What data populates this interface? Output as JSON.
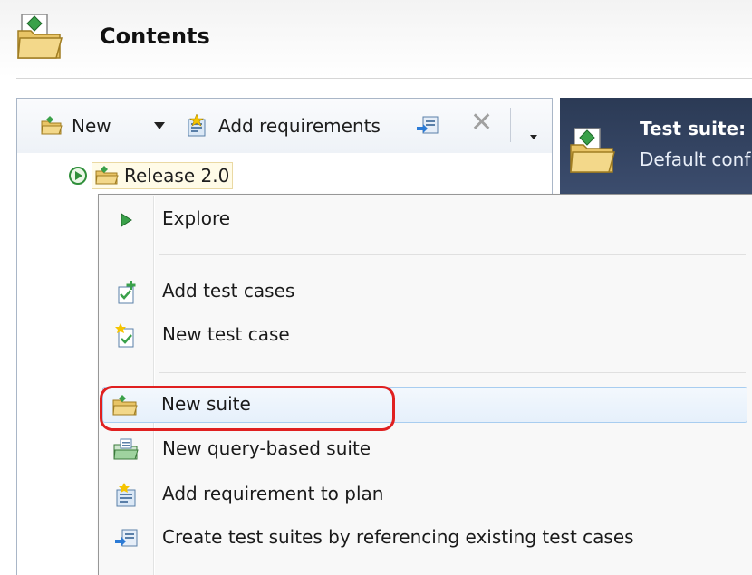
{
  "header": {
    "title": "Contents",
    "icon": "folder-suite-icon"
  },
  "toolbar": {
    "new_label": "New",
    "add_requirements_label": "Add requirements",
    "icons": [
      "new-suite-icon",
      "dropdown-arrow-icon",
      "add-requirements-icon",
      "reference-suites-icon",
      "delete-icon",
      "overflow-icon"
    ]
  },
  "tree": {
    "root_label": "Release 2.0",
    "icons": [
      "expand-run-icon",
      "suite-folder-icon"
    ]
  },
  "right_panel": {
    "title": "Test suite:",
    "subtitle": "Default conf"
  },
  "context_menu": {
    "items": [
      {
        "label": "Explore",
        "icon": "play-icon"
      },
      {
        "label": "Add test cases",
        "icon": "add-test-cases-icon"
      },
      {
        "label": "New test case",
        "icon": "new-test-case-icon"
      },
      {
        "label": "New suite",
        "icon": "new-suite-icon",
        "highlighted": true
      },
      {
        "label": "New query-based suite",
        "icon": "query-suite-icon"
      },
      {
        "label": "Add requirement to plan",
        "icon": "add-requirement-icon"
      },
      {
        "label": "Create test suites by referencing existing test cases",
        "icon": "reference-suites-icon"
      }
    ]
  },
  "colors": {
    "highlight_ring": "#e02020",
    "hover_bg": "#e6f0fb",
    "hover_border": "#a8cdf0",
    "right_panel_bg": "#2b3a55"
  }
}
